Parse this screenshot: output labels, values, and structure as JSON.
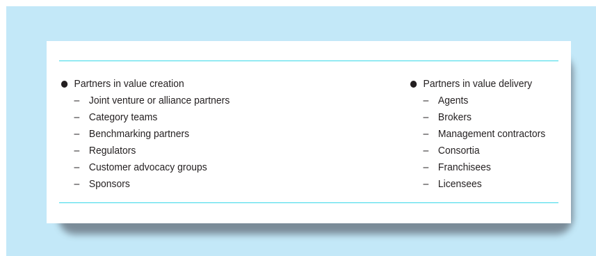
{
  "left_column": {
    "heading": "Partners in value creation",
    "items": [
      "Joint venture or alliance partners",
      "Category teams",
      "Benchmarking partners",
      "Regulators",
      "Customer advocacy groups",
      "Sponsors"
    ]
  },
  "right_column": {
    "heading": "Partners in value delivery",
    "items": [
      "Agents",
      "Brokers",
      "Management contractors",
      "Consortia",
      "Franchisees",
      "Licensees"
    ]
  },
  "list_marker": "–",
  "colors": {
    "background": "#c3e8f8",
    "rule": "#38d8e8",
    "card": "#ffffff",
    "text": "#231f20"
  }
}
